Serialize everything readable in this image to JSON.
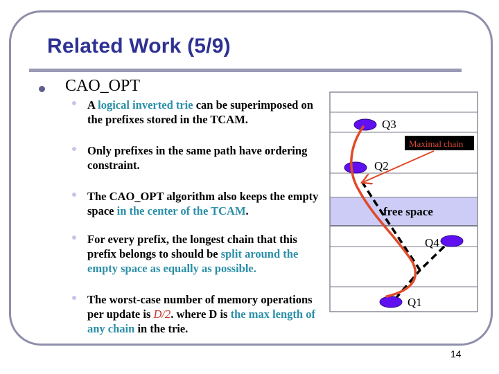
{
  "slide": {
    "title": "Related Work (5/9)",
    "page_number": "14"
  },
  "main_bullet": "CAO_OPT",
  "sub_bullets": [
    {
      "parts": [
        {
          "text": "A ",
          "style": "normal"
        },
        {
          "text": "logical inverted trie",
          "style": "highlight"
        },
        {
          "text": " can be superimposed on the prefixes stored in the TCAM.",
          "style": "normal"
        }
      ]
    },
    {
      "parts": [
        {
          "text": "Only prefixes in the same path have ordering constraint.",
          "style": "normal"
        }
      ]
    },
    {
      "parts": [
        {
          "text": "The CAO_OPT algorithm also keeps the empty space ",
          "style": "normal"
        },
        {
          "text": "in the center of the TCAM",
          "style": "highlight"
        },
        {
          "text": ".",
          "style": "normal"
        }
      ]
    },
    {
      "parts": [
        {
          "text": "For every prefix, the longest chain that this prefix belongs to should be ",
          "style": "normal"
        },
        {
          "text": "split around the empty space as equally as possible.",
          "style": "highlight"
        }
      ]
    },
    {
      "parts": [
        {
          "text": "The worst-case number of memory operations per update is ",
          "style": "normal"
        },
        {
          "text": "D/2",
          "style": "red-italic"
        },
        {
          "text": ". where D is ",
          "style": "normal"
        },
        {
          "text": "the max length of any chain",
          "style": "highlight"
        },
        {
          "text": " in the trie.",
          "style": "normal"
        }
      ]
    }
  ],
  "diagram": {
    "free_space_label": "free space",
    "maximal_chain_label": "Maximal chain",
    "nodes": [
      {
        "id": "Q3",
        "label": "Q3"
      },
      {
        "id": "Q2",
        "label": "Q2"
      },
      {
        "id": "Q4",
        "label": "Q4"
      },
      {
        "id": "Q1",
        "label": "Q1"
      }
    ],
    "colors": {
      "node_fill": "#6010f0",
      "chain_line": "#e04a2a",
      "free_space_fill": "#ccccf6",
      "grid_line": "#7a7a8a",
      "chain_label_bg": "#000000",
      "chain_label_text": "#d94b3a"
    }
  }
}
